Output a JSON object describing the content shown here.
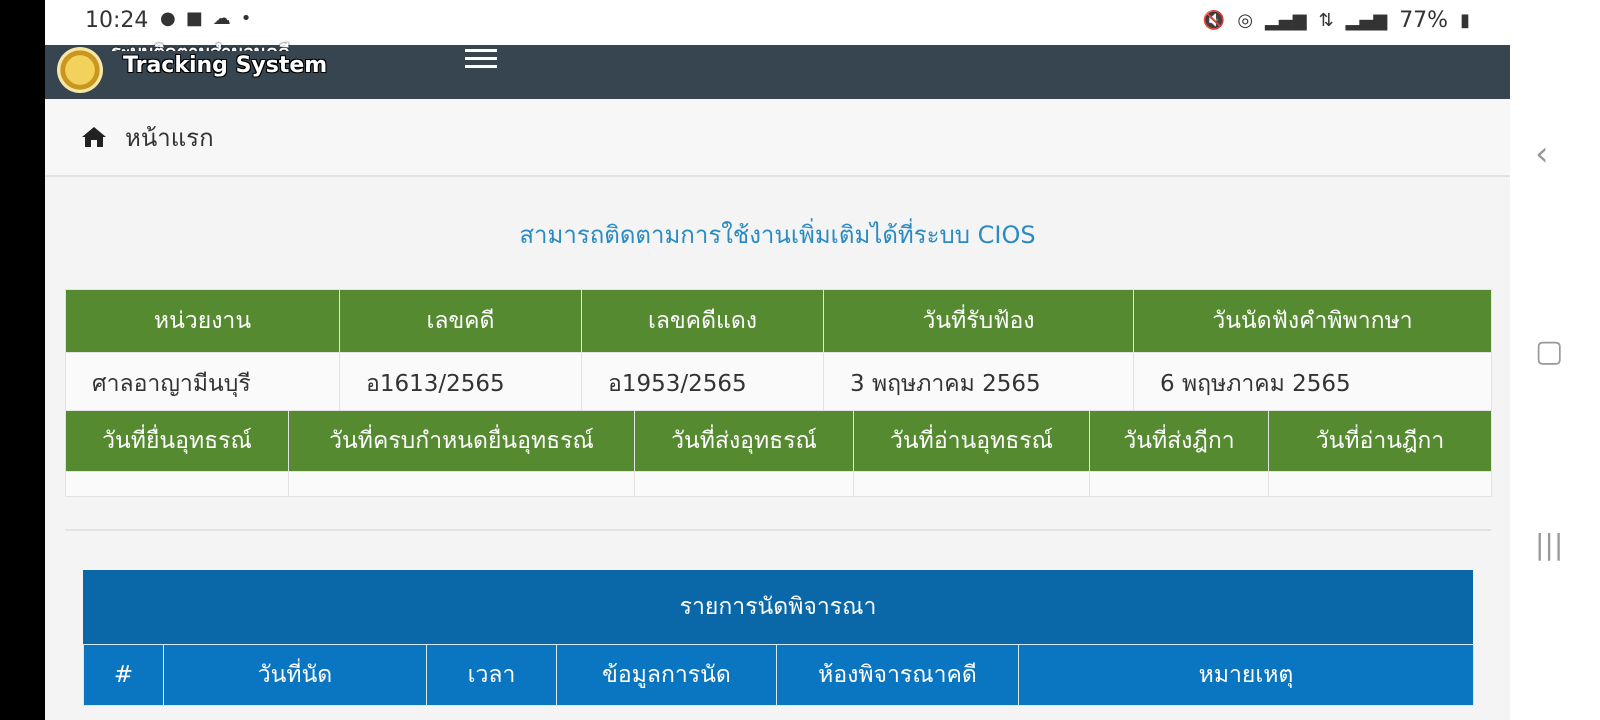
{
  "status_bar": {
    "time": "10:24",
    "left_icons": [
      "line-icon",
      "gallery-icon",
      "cloud-icon",
      "dot-icon"
    ],
    "right_icons": [
      "mute-icon",
      "hotspot-icon",
      "signal-icon",
      "4g-icon",
      "signal-icon-2"
    ],
    "battery": "77%"
  },
  "header": {
    "logo_text_top": "ระบบติดตามสำนวนคดี",
    "logo_text": "Tracking System"
  },
  "breadcrumb": {
    "home_label": "หน้าแรก"
  },
  "notice": "สามารถติดตามการใช้งานเพิ่มเติมได้ที่ระบบ CIOS",
  "case_table": {
    "headers": [
      "หน่วยงาน",
      "เลขคดี",
      "เลขคดีแดง",
      "วันที่รับฟ้อง",
      "วันนัดฟังคำพิพากษา"
    ],
    "row": [
      "ศาลอาญามีนบุรี",
      "อ1613/2565",
      "อ1953/2565",
      "3 พฤษภาคม 2565",
      "6 พฤษภาคม 2565"
    ]
  },
  "appeal_table": {
    "headers": [
      "วันที่ยื่นอุทธรณ์",
      "วันที่ครบกำหนดยื่นอุทธรณ์",
      "วันที่ส่งอุทธรณ์",
      "วันที่อ่านอุทธรณ์",
      "วันที่ส่งฎีกา",
      "วันที่อ่านฎีกา"
    ]
  },
  "hearing_list": {
    "title": "รายการนัดพิจารณา",
    "headers": [
      "#",
      "วันที่นัด",
      "เวลา",
      "ข้อมูลการนัด",
      "ห้องพิจารณาคดี",
      "หมายเหตุ"
    ]
  },
  "colors": {
    "header_bg": "#36454f",
    "table_green": "#568a31",
    "table_blue": "#0a75c0",
    "notice_blue": "#2a8bc3"
  }
}
